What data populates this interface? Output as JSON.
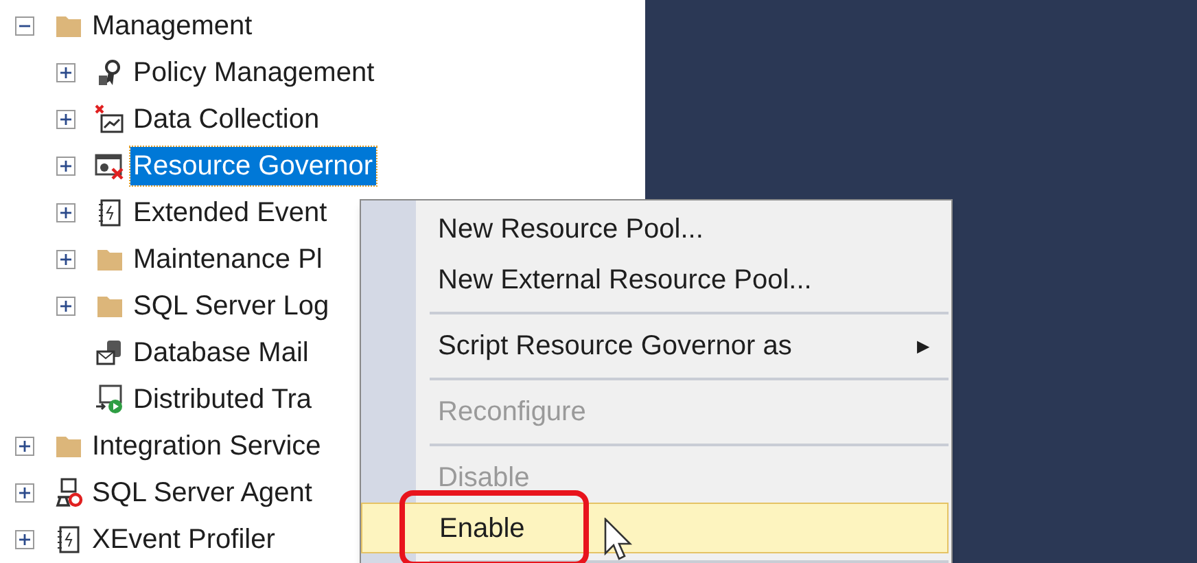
{
  "tree": [
    {
      "label": "Management",
      "kind": "folder",
      "expanded": true,
      "selected": false,
      "children": [
        {
          "label": "Policy Management",
          "kind": "policy",
          "expanded": false,
          "selected": false
        },
        {
          "label": "Data Collection",
          "kind": "collection",
          "expanded": false,
          "selected": false
        },
        {
          "label": "Resource Governor",
          "kind": "governor",
          "expanded": false,
          "selected": true
        },
        {
          "label": "Extended Event",
          "kind": "events",
          "expanded": false,
          "selected": false
        },
        {
          "label": "Maintenance Pl",
          "kind": "folder",
          "expanded": false,
          "selected": false
        },
        {
          "label": "SQL Server Log",
          "kind": "folder",
          "expanded": false,
          "selected": false
        },
        {
          "label": "Database Mail",
          "kind": "mail",
          "selected": false
        },
        {
          "label": "Distributed Tra",
          "kind": "transaction",
          "selected": false
        }
      ]
    },
    {
      "label": "Integration Service",
      "kind": "folder",
      "expanded": false,
      "selected": false
    },
    {
      "label": "SQL Server Agent",
      "kind": "agent",
      "expanded": false,
      "selected": false
    },
    {
      "label": "XEvent Profiler",
      "kind": "events",
      "expanded": false,
      "selected": false
    }
  ],
  "context_menu": [
    {
      "kind": "item",
      "label": "New Resource Pool...",
      "disabled": false,
      "selected": false
    },
    {
      "kind": "item",
      "label": "New External Resource Pool...",
      "disabled": false,
      "selected": false
    },
    {
      "kind": "separator"
    },
    {
      "kind": "submenu",
      "label": "Script Resource Governor as",
      "arrow": "▶",
      "disabled": false,
      "selected": false
    },
    {
      "kind": "separator"
    },
    {
      "kind": "item",
      "label": "Reconfigure",
      "disabled": true,
      "selected": false
    },
    {
      "kind": "separator"
    },
    {
      "kind": "item",
      "label": "Disable",
      "disabled": true,
      "selected": false
    },
    {
      "kind": "item",
      "label": "Enable",
      "disabled": false,
      "selected": true,
      "highlighted_callout": true
    },
    {
      "kind": "separator"
    }
  ]
}
